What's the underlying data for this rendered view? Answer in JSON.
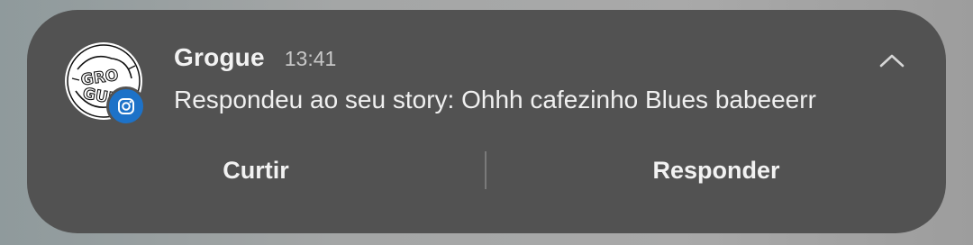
{
  "notification": {
    "sender": "Grogue",
    "time": "13:41",
    "message": "Respondeu ao seu story: Ohhh cafezinho Blues babeeerr",
    "app_icon": "instagram-icon",
    "avatar_logo_text": "GRO GUE",
    "collapse_icon": "chevron-up-icon"
  },
  "actions": {
    "like_label": "Curtir",
    "reply_label": "Responder"
  },
  "colors": {
    "card_background": "#525252",
    "badge": "#1d72c8"
  }
}
